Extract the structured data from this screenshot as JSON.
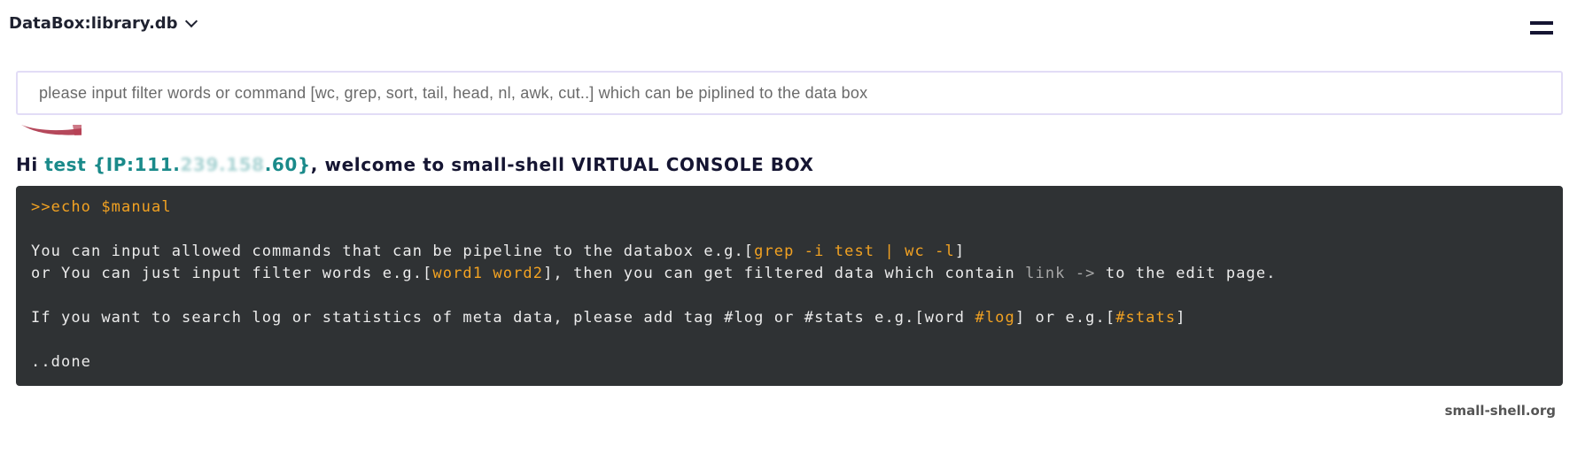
{
  "header": {
    "title": "DataBox:library.db",
    "chevron_icon": "chevron-down-icon",
    "menu_icon": "hamburger-menu-icon"
  },
  "search": {
    "placeholder": "please input filter words or command [wc, grep, sort, tail, head, nl, awk, cut..] which can be piplined to the data box",
    "value": ""
  },
  "welcome": {
    "greeting": "Hi ",
    "user": "test",
    "ip_prefix": " {IP:111.",
    "ip_hidden": "239.158",
    "ip_suffix": ".60}",
    "message": ", welcome to small-shell VIRTUAL CONSOLE BOX"
  },
  "console": {
    "command": ">>echo $manual",
    "line1": {
      "text": "You can input allowed commands that can be pipeline to the databox e.g.[",
      "example": "grep -i test | wc -l",
      "close": "]"
    },
    "line2": {
      "text": "or You can just input filter words e.g.[",
      "example": "word1 word2",
      "mid": "], then you can get filtered data which contain ",
      "link": "link ->",
      "end": " to the edit page."
    },
    "line3": {
      "text": "If you want to search log or statistics of meta data, please add tag #log or #stats e.g.[word ",
      "tag1": "#log",
      "mid": "] or e.g.[",
      "tag2": "#stats",
      "close": "]"
    },
    "done": "..done"
  },
  "footer": {
    "text": "small-shell.org"
  },
  "colors": {
    "console_bg": "#2f3234",
    "accent_orange": "#f2a222",
    "teal": "#1a8a8a",
    "navy": "#151532"
  }
}
